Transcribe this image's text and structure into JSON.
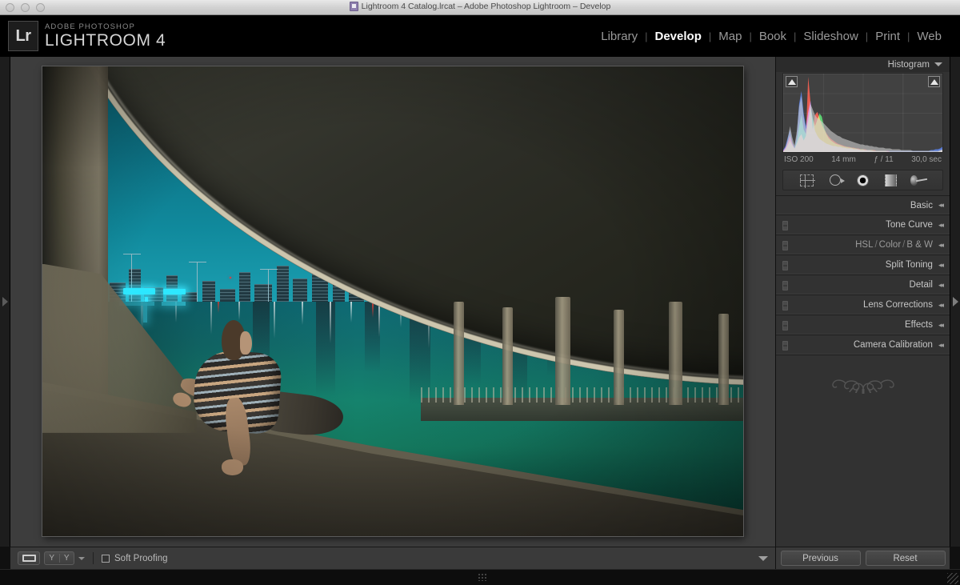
{
  "window": {
    "title": "Lightroom 4 Catalog.lrcat – Adobe Photoshop Lightroom – Develop",
    "doc_icon": "lrcat-document-icon",
    "controls": [
      "close-button",
      "minimize-button",
      "zoom-button"
    ]
  },
  "header": {
    "logo_mark": "Lr",
    "superscript": "ADOBE PHOTOSHOP",
    "product": "LIGHTROOM 4",
    "modules": [
      {
        "label": "Library",
        "active": false
      },
      {
        "label": "Develop",
        "active": true
      },
      {
        "label": "Map",
        "active": false
      },
      {
        "label": "Book",
        "active": false
      },
      {
        "label": "Slideshow",
        "active": false
      },
      {
        "label": "Print",
        "active": false
      },
      {
        "label": "Web",
        "active": false
      }
    ],
    "separator": "|"
  },
  "photo": {
    "description": "Night photograph under a curved concrete highway overpass: a boy in a striped shirt reclines on a concrete ledge watching the illuminated Dubai skyline and its mirror reflection in still green-teal water.",
    "sky_color": "#10899c",
    "water_color": "#15836d",
    "concrete_color": "#8e8570",
    "neon_color": "#2ee8ff"
  },
  "toolbar": {
    "loupe_view": "loupe-view",
    "before_after_left": "Y",
    "before_after_right": "Y",
    "soft_proofing_label": "Soft Proofing",
    "soft_proofing_checked": false
  },
  "right_panel": {
    "histogram": {
      "title": "Histogram",
      "shadow_clipping": "shadow-clipping-indicator",
      "highlight_clipping": "highlight-clipping-indicator",
      "meta": {
        "iso": "ISO 200",
        "focal_length": "14 mm",
        "aperture": "ƒ / 11",
        "shutter": "30,0 sec"
      }
    },
    "tools": [
      {
        "name": "crop-overlay-tool"
      },
      {
        "name": "spot-removal-tool"
      },
      {
        "name": "red-eye-correction-tool"
      },
      {
        "name": "graduated-filter-tool"
      },
      {
        "name": "adjustment-brush-tool"
      }
    ],
    "panels": [
      {
        "label": "Basic",
        "has_switch": false,
        "multi": false
      },
      {
        "label": "Tone Curve",
        "has_switch": true,
        "multi": false
      },
      {
        "label": "HSL / Color / B & W",
        "has_switch": true,
        "multi": true,
        "parts": [
          "HSL",
          "Color",
          "B & W"
        ],
        "part_sep": "/"
      },
      {
        "label": "Split Toning",
        "has_switch": true,
        "multi": false
      },
      {
        "label": "Detail",
        "has_switch": true,
        "multi": false
      },
      {
        "label": "Lens Corrections",
        "has_switch": true,
        "multi": false
      },
      {
        "label": "Effects",
        "has_switch": true,
        "multi": false
      },
      {
        "label": "Camera Calibration",
        "has_switch": true,
        "multi": false
      }
    ],
    "collapse_arrow": "◂◂",
    "buttons": {
      "previous": "Previous",
      "reset": "Reset"
    }
  },
  "chart_data": {
    "type": "area",
    "title": "Histogram",
    "xlabel": "",
    "ylabel": "",
    "xlim": [
      0,
      255
    ],
    "ylim": [
      0,
      100
    ],
    "grid": true,
    "legend": "none",
    "series": [
      {
        "name": "luminance",
        "color": "#c9c9c9",
        "values": [
          2,
          6,
          18,
          34,
          20,
          10,
          28,
          58,
          72,
          46,
          30,
          44,
          62,
          55,
          48,
          44,
          42,
          40,
          37,
          34,
          31,
          28,
          26,
          24,
          22,
          21,
          19,
          18,
          17,
          16,
          15,
          14,
          13,
          12,
          11,
          11,
          10,
          10,
          9,
          9,
          8,
          8,
          7,
          7,
          7,
          6,
          6,
          6,
          5,
          5,
          5,
          5,
          4,
          4,
          4,
          4,
          4,
          3,
          3,
          3,
          3,
          3,
          3,
          3,
          3,
          3,
          3,
          3,
          3,
          4,
          5
        ]
      },
      {
        "name": "red",
        "color": "#ff2a17",
        "values": [
          3,
          7,
          14,
          22,
          12,
          6,
          12,
          20,
          24,
          16,
          22,
          96,
          64,
          30,
          48,
          52,
          44,
          36,
          30,
          25,
          21,
          18,
          16,
          14,
          12,
          11,
          10,
          9,
          8,
          8,
          7,
          7,
          6,
          6,
          5,
          5,
          5,
          4,
          4,
          4,
          4,
          3,
          3,
          3,
          3,
          3,
          3,
          2,
          2,
          2,
          2,
          2,
          2,
          2,
          2,
          2,
          2,
          2,
          2,
          2,
          2,
          2,
          2,
          2,
          2,
          2,
          2,
          2,
          2,
          3,
          4
        ]
      },
      {
        "name": "green",
        "color": "#2ad84a",
        "values": [
          2,
          5,
          10,
          16,
          10,
          6,
          16,
          34,
          48,
          30,
          24,
          40,
          58,
          44,
          34,
          42,
          50,
          46,
          32,
          24,
          19,
          16,
          14,
          12,
          11,
          10,
          9,
          8,
          8,
          7,
          7,
          6,
          6,
          5,
          5,
          5,
          4,
          4,
          4,
          4,
          3,
          3,
          3,
          3,
          3,
          3,
          2,
          2,
          2,
          2,
          2,
          2,
          2,
          2,
          2,
          2,
          2,
          2,
          2,
          2,
          2,
          2,
          2,
          2,
          2,
          2,
          2,
          2,
          2,
          3,
          4
        ]
      },
      {
        "name": "blue",
        "color": "#2356e0",
        "values": [
          4,
          9,
          20,
          30,
          14,
          8,
          24,
          62,
          78,
          50,
          34,
          52,
          66,
          42,
          28,
          22,
          18,
          16,
          14,
          12,
          11,
          10,
          9,
          9,
          8,
          8,
          7,
          7,
          6,
          6,
          6,
          5,
          5,
          5,
          4,
          4,
          4,
          4,
          4,
          3,
          3,
          3,
          3,
          3,
          3,
          3,
          3,
          3,
          3,
          3,
          3,
          3,
          3,
          3,
          3,
          3,
          3,
          3,
          3,
          3,
          3,
          3,
          3,
          3,
          3,
          4,
          4,
          5,
          5,
          6,
          8
        ]
      }
    ],
    "annotations": [
      "ISO 200",
      "14 mm",
      "ƒ / 11",
      "30,0 sec"
    ]
  }
}
